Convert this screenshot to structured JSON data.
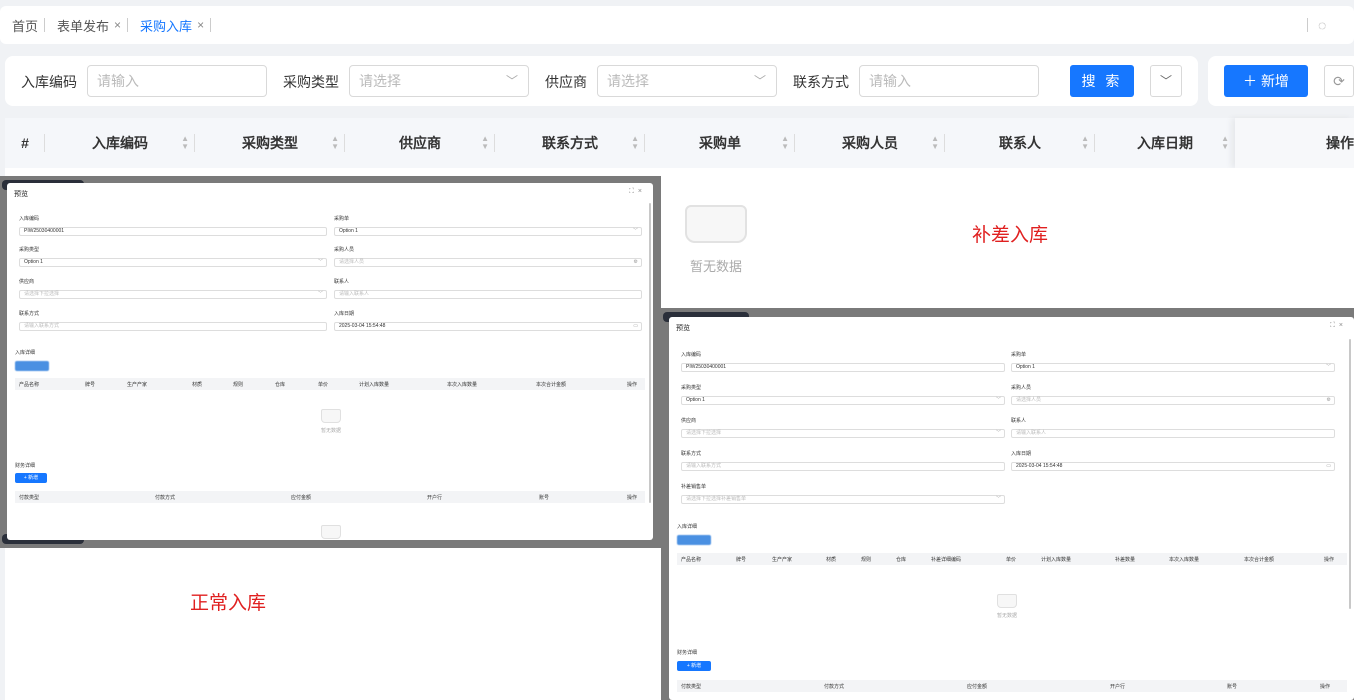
{
  "tabs": [
    {
      "label": "首页",
      "closable": false,
      "active": false
    },
    {
      "label": "表单发布",
      "closable": true,
      "active": false
    },
    {
      "label": "采购入库",
      "closable": true,
      "active": true
    }
  ],
  "search": {
    "fields": [
      {
        "label": "入库编码",
        "placeholder": "请输入",
        "type": "input"
      },
      {
        "label": "采购类型",
        "placeholder": "请选择",
        "type": "select"
      },
      {
        "label": "供应商",
        "placeholder": "请选择",
        "type": "select"
      },
      {
        "label": "联系方式",
        "placeholder": "请输入",
        "type": "input"
      }
    ],
    "search_label": "搜 索"
  },
  "toolbar": {
    "add_label": "新增"
  },
  "table": {
    "columns": [
      "#",
      "入库编码",
      "采购类型",
      "供应商",
      "联系方式",
      "采购单",
      "采购人员",
      "联系人",
      "入库日期",
      "操作"
    ],
    "empty_text": "暂无数据"
  },
  "annotations": {
    "supplement": "补差入库",
    "normal": "正常入库"
  },
  "preview_normal": {
    "title": "预览",
    "fields": [
      {
        "label": "入库编码",
        "value": "PIW25030400001",
        "placeholder": false,
        "icon": ""
      },
      {
        "label": "采购单",
        "value": "Option 1",
        "placeholder": false,
        "icon": "chevron-down-icon"
      },
      {
        "label": "采购类型",
        "value": "Option 1",
        "placeholder": false,
        "icon": "chevron-down-icon"
      },
      {
        "label": "采购人员",
        "value": "请选择人员",
        "placeholder": true,
        "icon": "gear-icon"
      },
      {
        "label": "供应商",
        "value": "请选择下拉选择",
        "placeholder": true,
        "icon": "chevron-down-icon"
      },
      {
        "label": "联系人",
        "value": "请输入联系人",
        "placeholder": true,
        "icon": ""
      },
      {
        "label": "联系方式",
        "value": "请输入联系方式",
        "placeholder": true,
        "icon": ""
      },
      {
        "label": "入库日期",
        "value": "2025-03-04 15:54:48",
        "placeholder": false,
        "icon": "calendar-icon"
      }
    ],
    "detail_title": "入库详细",
    "detail_columns": [
      "产品名称",
      "牌号",
      "生产产家",
      "材质",
      "规则",
      "仓库",
      "单价",
      "计划入库数量",
      "本次入库数量",
      "本次合计金额",
      "操作"
    ],
    "empty_text": "暂无数据",
    "finance_title": "财务详细",
    "finance_add_label": "+ 新增",
    "finance_columns": [
      "付款类型",
      "付款方式",
      "应付金额",
      "开户行",
      "账号",
      "操作"
    ]
  },
  "preview_supplement": {
    "title": "预览",
    "fields": [
      {
        "label": "入库编码",
        "value": "PIW25030400001",
        "placeholder": false,
        "icon": ""
      },
      {
        "label": "采购单",
        "value": "Option 1",
        "placeholder": false,
        "icon": "chevron-down-icon"
      },
      {
        "label": "采购类型",
        "value": "Option 1",
        "placeholder": false,
        "icon": "chevron-down-icon"
      },
      {
        "label": "采购人员",
        "value": "请选择人员",
        "placeholder": true,
        "icon": "gear-icon"
      },
      {
        "label": "供应商",
        "value": "请选择下拉选择",
        "placeholder": true,
        "icon": "chevron-down-icon"
      },
      {
        "label": "联系人",
        "value": "请输入联系人",
        "placeholder": true,
        "icon": ""
      },
      {
        "label": "联系方式",
        "value": "请输入联系方式",
        "placeholder": true,
        "icon": ""
      },
      {
        "label": "入库日期",
        "value": "2025-03-04 15:54:48",
        "placeholder": false,
        "icon": "calendar-icon"
      },
      {
        "label": "补差销售单",
        "value": "请选择下拉选择补差销售单",
        "placeholder": true,
        "icon": "chevron-down-icon"
      }
    ],
    "detail_title": "入库详细",
    "detail_columns": [
      "产品名称",
      "牌号",
      "生产产家",
      "材质",
      "规则",
      "仓库",
      "补差详细编码",
      "单价",
      "计划入库数量",
      "补差数量",
      "本次入库数量",
      "本次合计金额",
      "操作"
    ],
    "empty_text": "暂无数据",
    "finance_title": "财务详细",
    "finance_add_label": "+ 新增",
    "finance_columns": [
      "付款类型",
      "付款方式",
      "应付金额",
      "开户行",
      "账号",
      "操作"
    ]
  }
}
